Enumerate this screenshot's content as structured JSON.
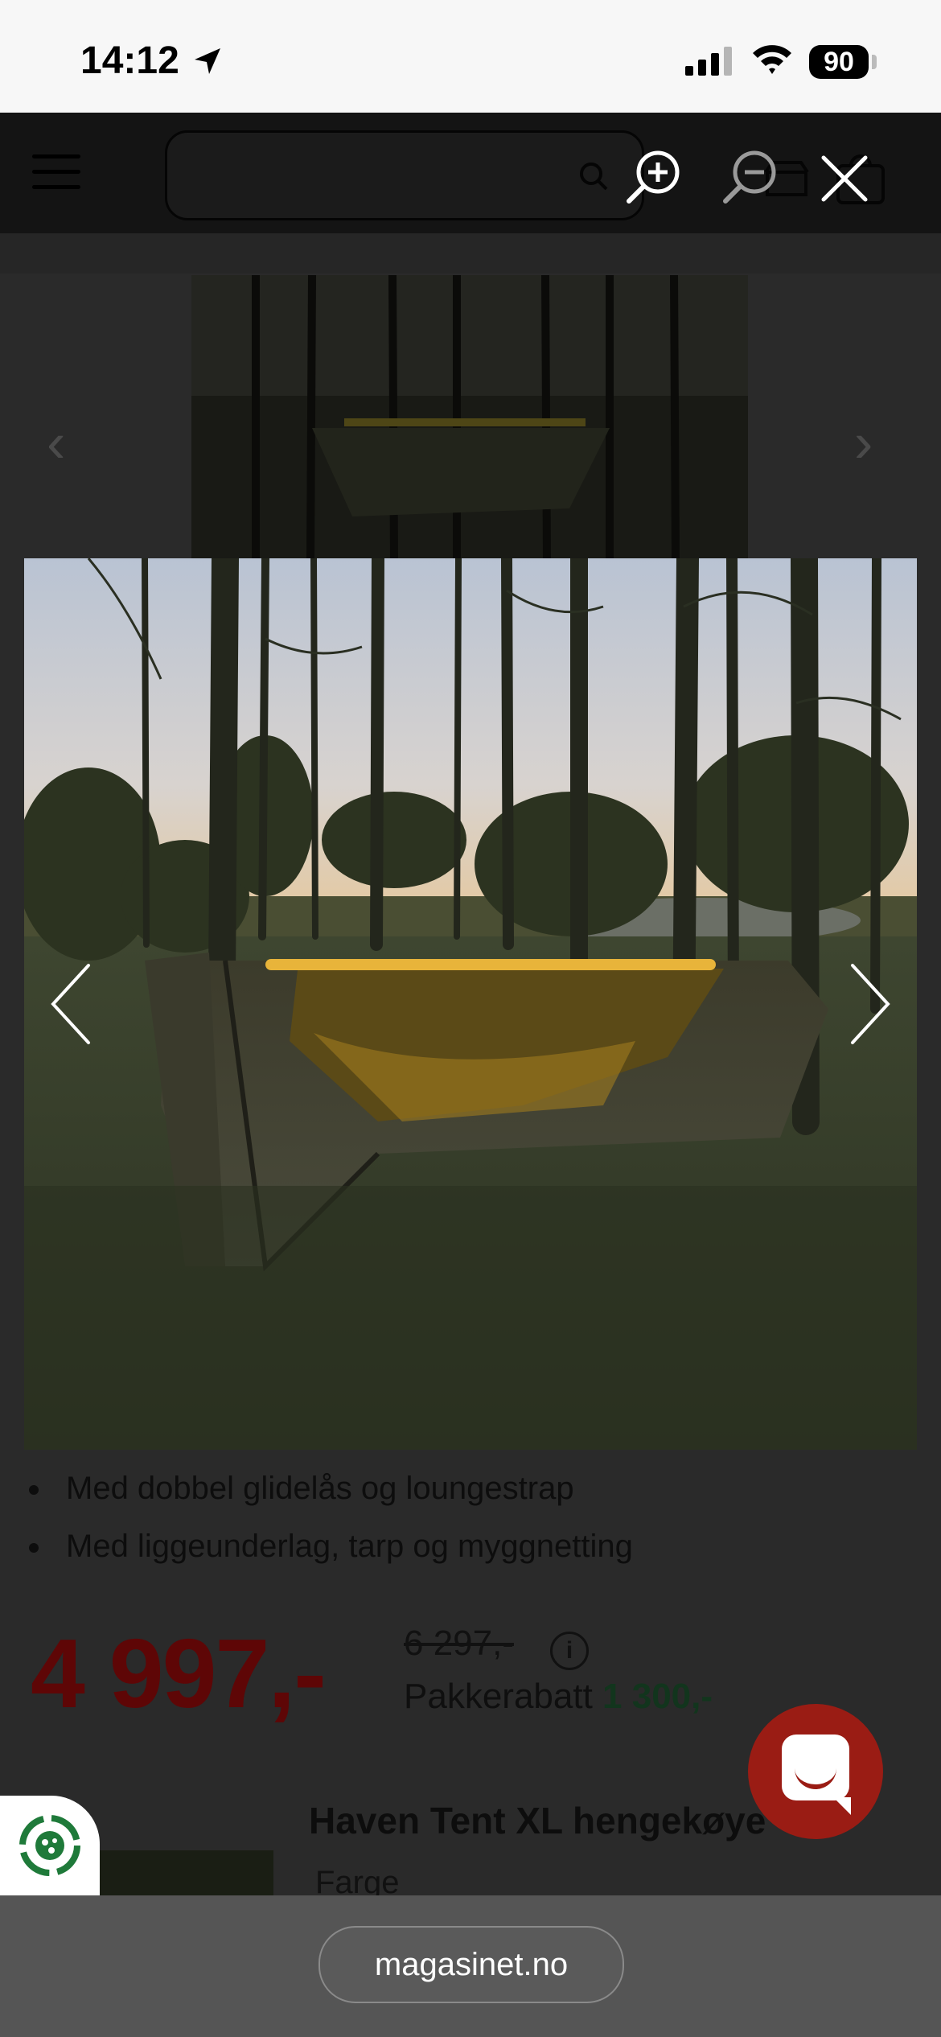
{
  "status_bar": {
    "time": "14:12",
    "battery": "90"
  },
  "gallery": {
    "zoom_in": "zoom-in-icon",
    "zoom_out": "zoom-out-icon",
    "close": "close-icon",
    "prev": "chevron-left-icon",
    "next": "chevron-right-icon"
  },
  "product": {
    "features": [
      "Med dobbel glidelås og loungestrap",
      "Med liggeunderlag, tarp og myggnetting"
    ],
    "price": "4 997,-",
    "old_price": "6 297,-",
    "discount_label": "Pakkerabatt",
    "discount_value": "1 300,-",
    "bundle_title": "Haven Tent XL hengekøye",
    "bundle_option": "Farge"
  },
  "browser": {
    "url": "magasinet.no"
  },
  "colors": {
    "price": "#5e0606",
    "chat": "#9a1c14",
    "discount": "#12351d"
  }
}
